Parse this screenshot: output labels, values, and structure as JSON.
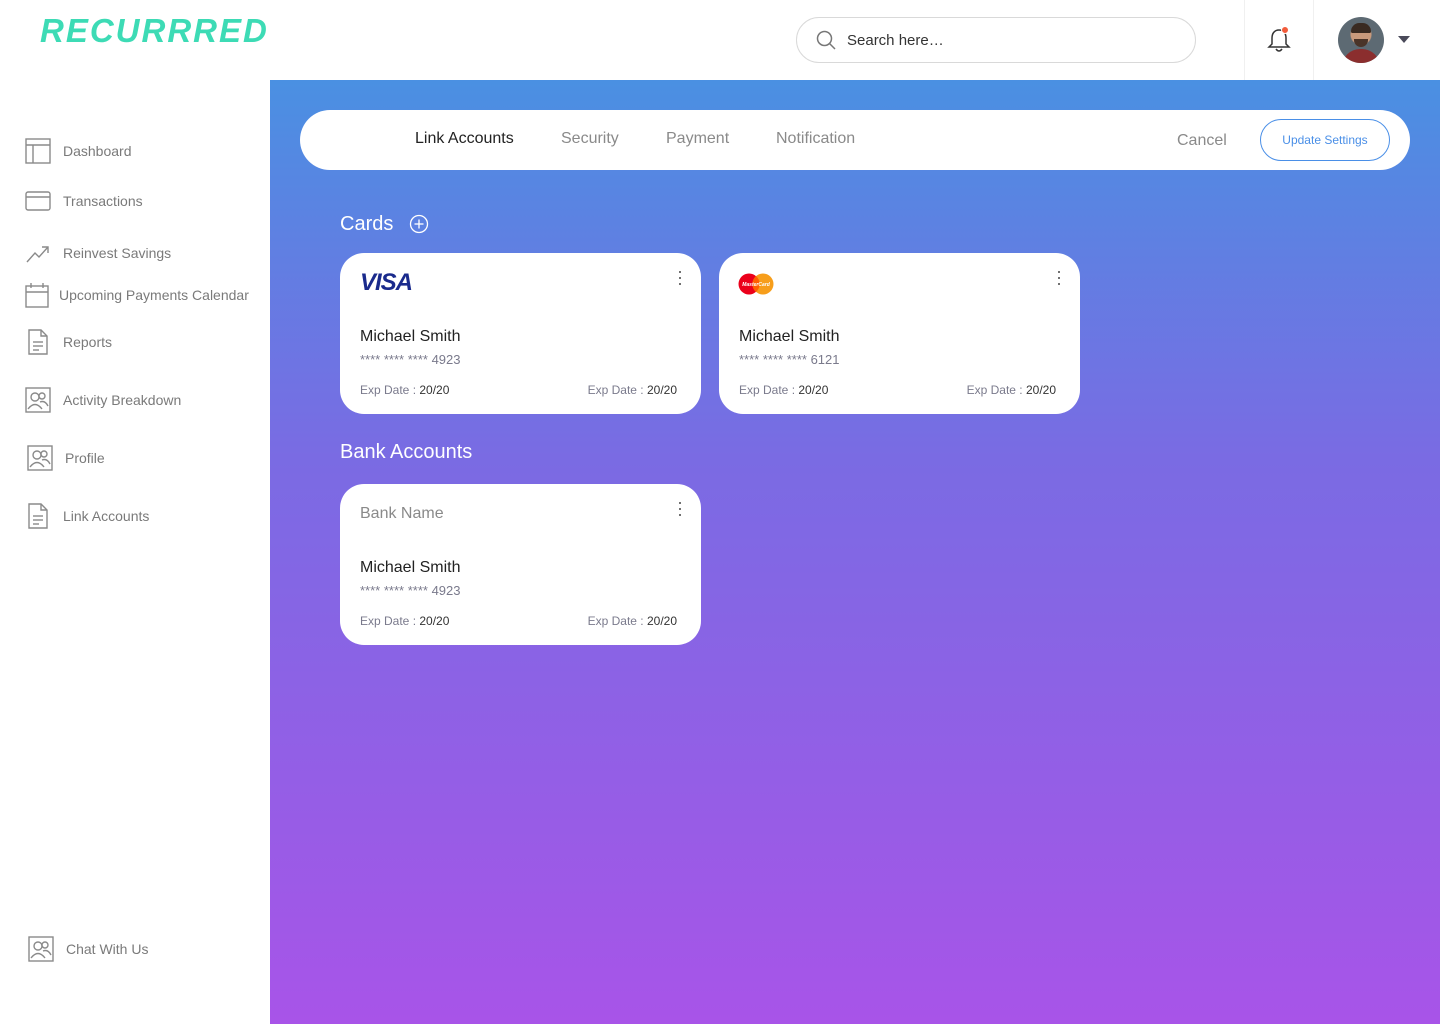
{
  "header": {
    "logo": "RECURRRED",
    "search_placeholder": "Search here…",
    "notification_count": 1
  },
  "sidebar": {
    "items": [
      {
        "label": "Dashboard",
        "icon": "dashboard-icon"
      },
      {
        "label": "Transactions",
        "icon": "credit-card-icon"
      },
      {
        "label": "Reinvest Savings",
        "icon": "trending-up-icon"
      },
      {
        "label": "Upcoming Payments Calendar",
        "icon": "calendar-icon"
      },
      {
        "label": "Reports",
        "icon": "document-icon"
      },
      {
        "label": "Activity Breakdown",
        "icon": "users-icon"
      },
      {
        "label": "Profile",
        "icon": "users-icon"
      },
      {
        "label": "Link Accounts",
        "icon": "document-icon"
      }
    ],
    "chat": {
      "label": "Chat With Us",
      "icon": "users-icon"
    }
  },
  "settings": {
    "tabs": [
      {
        "label": "Link Accounts",
        "active": true
      },
      {
        "label": "Security",
        "active": false
      },
      {
        "label": "Payment",
        "active": false
      },
      {
        "label": "Notification",
        "active": false
      }
    ],
    "cancel_label": "Cancel",
    "update_label": "Update Settings"
  },
  "cards_section": {
    "title": "Cards",
    "cards": [
      {
        "brand": "VISA",
        "name": "Michael Smith",
        "number_mask": "**** **** ****",
        "last4": "4923",
        "exp_label": "Exp Date :",
        "exp_value": "20/20"
      },
      {
        "brand": "MasterCard",
        "name": "Michael Smith",
        "number_mask": "**** **** ****",
        "last4": "6121",
        "exp_label": "Exp Date :",
        "exp_value": "20/20"
      }
    ]
  },
  "bank_section": {
    "title": "Bank Accounts",
    "accounts": [
      {
        "bank_name": "Bank Name",
        "name": "Michael Smith",
        "number_mask": "**** **** ****",
        "last4": "4923",
        "exp_label": "Exp Date :",
        "exp_value": "20/20"
      }
    ]
  },
  "colors": {
    "brand": "#3ddbb5",
    "accent": "#4a8fe7",
    "gradient_top": "#4a90e2",
    "gradient_bottom": "#a854e8"
  }
}
